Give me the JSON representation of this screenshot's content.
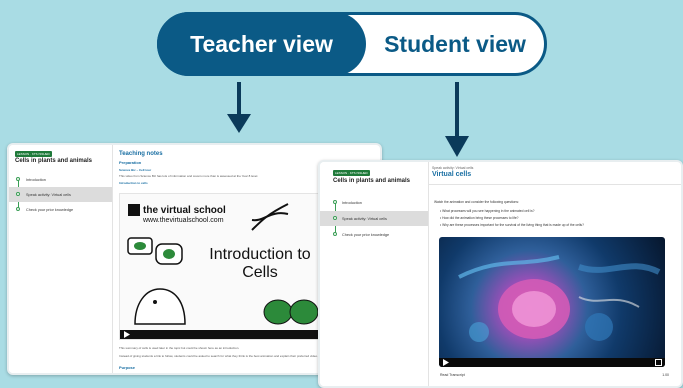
{
  "toggle": {
    "teacher_label": "Teacher view",
    "student_label": "Student view"
  },
  "lesson": {
    "badge": "LESSON · KTS ISSUED",
    "title": "Cells in plants and animals",
    "steps": [
      "Introduction",
      "Speak activity: Virtual cells",
      "Check your prior knowledge"
    ],
    "active_step": 1
  },
  "teacher": {
    "heading": "Teaching notes",
    "section1": "Preparation",
    "item_link": "Science Biz – Cell tour",
    "item_text": "This video from Science Biz has lots of information and covers more than is assessed at the Year 8 level.",
    "intro_link": "Introduction to cells",
    "poster_logo": "the virtual school",
    "poster_site": "www.thevirtualschool.com",
    "poster_title": "Introduction to Cells",
    "after1": "This summary of cells is used later in the topic but could be shown here as an introduction.",
    "after2": "Instead of giving students a link to follow, students could be asked to search for what they think is the best animation and explain their preferred video.",
    "purpose": "Purpose"
  },
  "student": {
    "crumb": "Speak activity: Virtual cells",
    "title": "Virtual cells",
    "prompt": "Watch the animation and consider the following questions:",
    "questions": [
      "What processes will you see happening in the animated cell is?",
      "How did the animation bring these processes to life?",
      "Why are these processes important for the survival of the living thing that is made up of the cells?"
    ],
    "transcript": "Read Transcript",
    "speed": "1.00"
  },
  "colors": {
    "brand": "#0b5a86",
    "background": "#a9dce4",
    "link": "#1a6fa3",
    "step": "#3a9e55"
  }
}
